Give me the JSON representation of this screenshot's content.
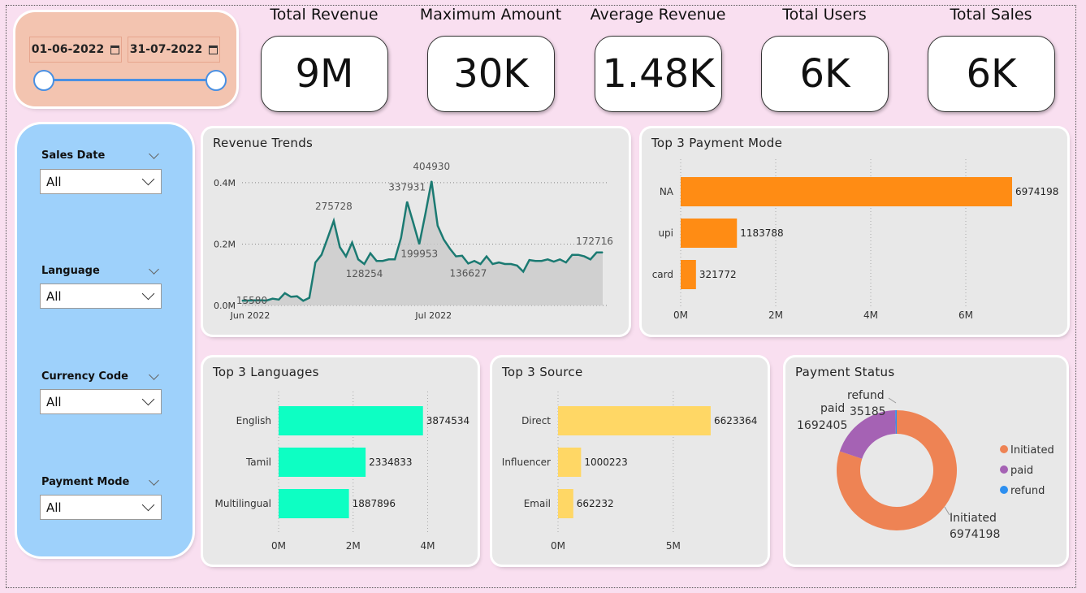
{
  "date_range": {
    "start": "01-06-2022",
    "end": "31-07-2022"
  },
  "kpis": [
    {
      "label": "Total Revenue",
      "value": "9M"
    },
    {
      "label": "Maximum Amount",
      "value": "30K"
    },
    {
      "label": "Average Revenue",
      "value": "1.48K"
    },
    {
      "label": "Total Users",
      "value": "6K"
    },
    {
      "label": "Total Sales",
      "value": "6K"
    }
  ],
  "filters": [
    {
      "label": "Sales Date",
      "value": "All"
    },
    {
      "label": "Language",
      "value": "All"
    },
    {
      "label": "Currency Code",
      "value": "All"
    },
    {
      "label": "Payment Mode",
      "value": "All"
    }
  ],
  "chart_data": [
    {
      "type": "area",
      "title": "Revenue Trends",
      "x_ticks": [
        "Jun 2022",
        "Jul 2022"
      ],
      "y_ticks": [
        "0.0M",
        "0.2M",
        "0.4M"
      ],
      "ylim": [
        0,
        450000
      ],
      "values": [
        15580,
        16000,
        16500,
        17000,
        16000,
        22000,
        19000,
        40000,
        28000,
        30000,
        15000,
        25000,
        140000,
        165000,
        220000,
        275728,
        190000,
        160000,
        205000,
        150000,
        135000,
        170000,
        145000,
        145000,
        150000,
        150000,
        220000,
        337931,
        270000,
        199953,
        300000,
        404930,
        260000,
        215000,
        185000,
        160000,
        162000,
        136627,
        145000,
        135000,
        160000,
        135000,
        140000,
        135000,
        135000,
        130000,
        110000,
        148000,
        145000,
        145000,
        150000,
        143000,
        150000,
        140000,
        165000,
        165000,
        160000,
        150000,
        172716,
        172716
      ],
      "data_labels": [
        {
          "index": 0,
          "text": "15580"
        },
        {
          "index": 15,
          "text": "275728"
        },
        {
          "index": 20,
          "text": "128254"
        },
        {
          "index": 27,
          "text": "337931"
        },
        {
          "index": 29,
          "text": "199953"
        },
        {
          "index": 31,
          "text": "404930"
        },
        {
          "index": 37,
          "text": "136627"
        },
        {
          "index": 59,
          "text": "172716"
        }
      ],
      "color": "#1b7a72"
    },
    {
      "type": "bar",
      "orientation": "horizontal",
      "title": "Top 3 Payment Mode",
      "categories": [
        "NA",
        "upi",
        "card"
      ],
      "values": [
        6974198,
        1183788,
        321772
      ],
      "x_ticks": [
        "0M",
        "2M",
        "4M",
        "6M"
      ],
      "xlim": [
        0,
        8000000
      ],
      "color": "#ff8c14"
    },
    {
      "type": "bar",
      "orientation": "horizontal",
      "title": "Top 3 Languages",
      "categories": [
        "English",
        "Tamil",
        "Multilingual"
      ],
      "values": [
        3874534,
        2334833,
        1887896
      ],
      "x_ticks": [
        "0M",
        "2M",
        "4M"
      ],
      "xlim": [
        0,
        4600000
      ],
      "color": "#0dffc3"
    },
    {
      "type": "bar",
      "orientation": "horizontal",
      "title": "Top 3 Source",
      "categories": [
        "Direct",
        "Influencer",
        "Email"
      ],
      "values": [
        6623364,
        1000223,
        662232
      ],
      "x_ticks": [
        "0M",
        "5M"
      ],
      "xlim": [
        0,
        8000000
      ],
      "color": "#ffd765"
    },
    {
      "type": "pie",
      "title": "Payment Status",
      "slices": [
        {
          "label": "Initiated",
          "value": 6974198,
          "color": "#ee8354"
        },
        {
          "label": "paid",
          "value": 1692405,
          "color": "#a562b4"
        },
        {
          "label": "refund",
          "value": 35185,
          "color": "#2d8ff0"
        }
      ],
      "legend": "right"
    }
  ]
}
